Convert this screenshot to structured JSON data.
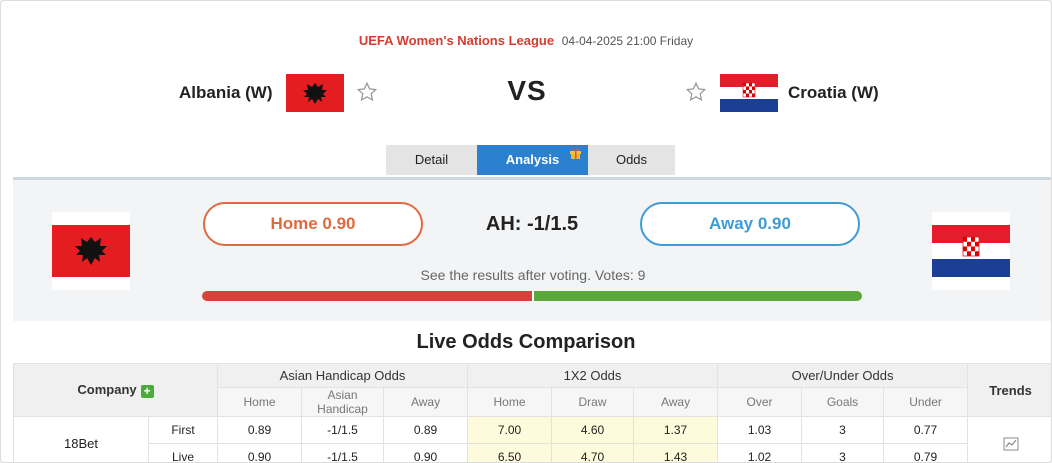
{
  "match": {
    "league": "UEFA Women's Nations League",
    "datetime": "04-04-2025 21:00 Friday",
    "home_team": "Albania (W)",
    "away_team": "Croatia (W)",
    "vs": "VS"
  },
  "tabs": [
    {
      "label": "Detail"
    },
    {
      "label": "Analysis",
      "active": true
    },
    {
      "label": "Odds"
    }
  ],
  "vote": {
    "home_label": "Home 0.90",
    "away_label": "Away 0.90",
    "handicap": "AH: -1/1.5",
    "note": "See the results after voting. Votes: 9",
    "home_share": 0.5,
    "away_share": 0.5,
    "home_color": "#d9423b",
    "away_color": "#5aa73c"
  },
  "odds": {
    "title": "Live Odds Comparison",
    "company_header": "Company",
    "trends_header": "Trends",
    "groups": [
      "Asian Handicap Odds",
      "1X2 Odds",
      "Over/Under Odds"
    ],
    "sub_headers": [
      "Home",
      "Asian Handicap",
      "Away",
      "Home",
      "Draw",
      "Away",
      "Over",
      "Goals",
      "Under"
    ],
    "rows": [
      {
        "company": "18Bet",
        "type": "First",
        "values": [
          "0.89",
          "-1/1.5",
          "0.89",
          "7.00",
          "4.60",
          "1.37",
          "1.03",
          "3",
          "0.77"
        ]
      },
      {
        "company": "18Bet",
        "type": "Live",
        "values": [
          "0.90",
          "-1/1.5",
          "0.90",
          "6.50",
          "4.70",
          "1.43",
          "1.02",
          "3",
          "0.79"
        ]
      }
    ]
  },
  "icons": {
    "favorite": "star-icon",
    "add_company": "plus-icon",
    "gift": "gift-icon",
    "trend": "chart-icon"
  },
  "colors": {
    "league": "#d63b2f",
    "tab_active": "#2b81d0",
    "home_accent": "#e06a3f",
    "away_accent": "#3d9bd8",
    "x12_bg": "#fdfbdc"
  }
}
